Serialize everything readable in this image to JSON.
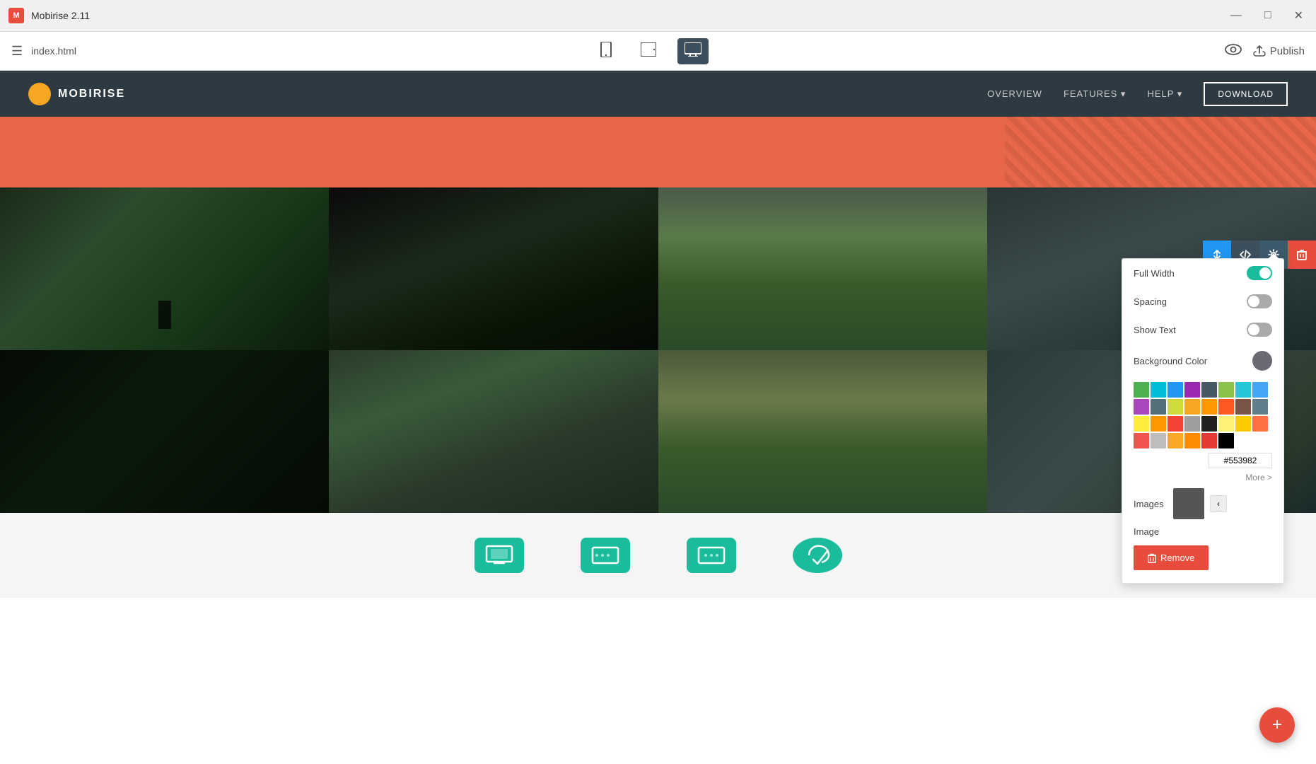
{
  "titlebar": {
    "logo_text": "M",
    "app_name": "Mobirise 2.11",
    "minimize_label": "—",
    "maximize_label": "□",
    "close_label": "✕"
  },
  "toolbar": {
    "hamburger_label": "☰",
    "file_name": "index.html",
    "mobile_icon": "📱",
    "tablet_icon": "⬜",
    "desktop_icon": "🖥",
    "preview_label": "👁",
    "publish_label": "Publish",
    "publish_upload_icon": "☁"
  },
  "site": {
    "navbar": {
      "logo_text": "MOBIRISE",
      "nav_links": [
        "OVERVIEW",
        "FEATURES ▾",
        "HELP ▾"
      ],
      "download_label": "DOWNLOAD"
    }
  },
  "settings_panel": {
    "full_width_label": "Full Width",
    "spacing_label": "Spacing",
    "show_text_label": "Show Text",
    "background_color_label": "Background Color",
    "images_label": "Images",
    "image_label": "Image",
    "more_label": "More >",
    "remove_label": "Remove",
    "hex_color": "#553982",
    "colors": [
      "#4CAF50",
      "#00BCD4",
      "#2196F3",
      "#9C27B0",
      "#455A64",
      "#8BC34A",
      "#26C6DA",
      "#42A5F5",
      "#AB47BC",
      "#546E7A",
      "#CDDC39",
      "#F5A623",
      "#FF9800",
      "#FF5722",
      "#795548",
      "#FFEB3B",
      "#FF9800",
      "#F44336",
      "#9E9E9E",
      "#212121",
      "#FFF176",
      "#FFCC02",
      "#FF7043",
      "#EF5350",
      "#BDBDBD",
      "#F9A825",
      "#FF8C00",
      "#E53935",
      "#757575",
      "#000000"
    ]
  },
  "block_controls": {
    "arrows_icon": "⇅",
    "code_icon": "</>",
    "gear_icon": "⚙",
    "trash_icon": "🗑"
  },
  "fab": {
    "label": "+"
  }
}
